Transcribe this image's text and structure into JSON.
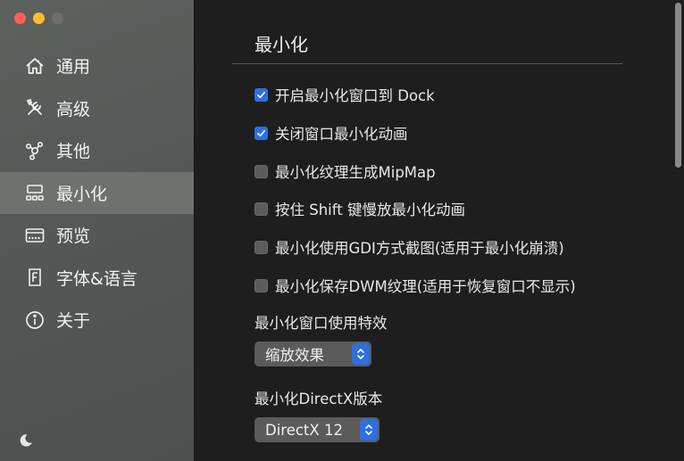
{
  "window": {
    "traffic_lights": {
      "close": "#fe5f57",
      "minimize": "#febc2e",
      "zoom": "#6e6e6e"
    }
  },
  "sidebar": {
    "items": [
      {
        "label": "通用",
        "icon": "house-icon",
        "active": false
      },
      {
        "label": "高级",
        "icon": "tools-icon",
        "active": false
      },
      {
        "label": "其他",
        "icon": "molecule-icon",
        "active": false
      },
      {
        "label": "最小化",
        "icon": "minimize-grid-icon",
        "active": true
      },
      {
        "label": "预览",
        "icon": "preview-icon",
        "active": false
      },
      {
        "label": "字体&语言",
        "icon": "font-icon",
        "active": false
      },
      {
        "label": "关于",
        "icon": "info-icon",
        "active": false
      }
    ],
    "footer_icon": "moon-icon"
  },
  "main": {
    "title": "最小化",
    "options": [
      {
        "label": "开启最小化窗口到 Dock",
        "checked": true
      },
      {
        "label": "关闭窗口最小化动画",
        "checked": true
      },
      {
        "label": "最小化纹理生成MipMap",
        "checked": false
      },
      {
        "label": "按住 Shift 键慢放最小化动画",
        "checked": false
      },
      {
        "label": "最小化使用GDI方式截图(适用于最小化崩溃)",
        "checked": false
      },
      {
        "label": "最小化保存DWM纹理(适用于恢复窗口不显示)",
        "checked": false
      }
    ],
    "effect": {
      "label": "最小化窗口使用特效",
      "value": "缩放效果"
    },
    "directx": {
      "label": "最小化DirectX版本",
      "value": "DirectX 12"
    }
  },
  "colors": {
    "accent": "#2f6fe0",
    "sidebar_active": "#6f716f"
  }
}
